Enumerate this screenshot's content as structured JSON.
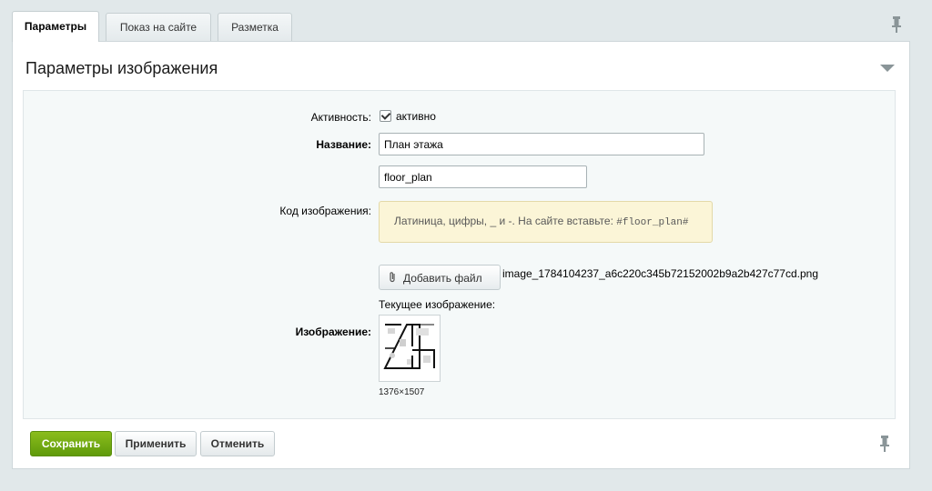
{
  "tabs": [
    {
      "label": "Параметры",
      "active": true
    },
    {
      "label": "Показ на сайте",
      "active": false
    },
    {
      "label": "Разметка",
      "active": false
    }
  ],
  "section": {
    "title": "Параметры изображения"
  },
  "form": {
    "activity_label": "Активность:",
    "activity_checkbox_text": "активно",
    "activity_checked": true,
    "name_label": "Название:",
    "name_value": "План этажа",
    "code_value": "floor_plan",
    "code_label": "Код изображения:",
    "code_hint_text": "Латиница, цифры, _ и -. На сайте вставьте: ",
    "code_hint_code": "#floor_plan#",
    "add_file_label": "Добавить файл",
    "file_name": "image_1784104237_a6c220c345b72152002b9a2b427c77cd.png",
    "current_image_label": "Текущее изображение:",
    "image_label": "Изображение:",
    "image_dimensions": "1376×1507"
  },
  "buttons": {
    "save": "Сохранить",
    "apply": "Применить",
    "cancel": "Отменить"
  },
  "colors": {
    "save_button": "#6fa713",
    "hint_background": "#fbf5d7",
    "page_background": "#e1e8ea"
  },
  "icons": [
    "pin-icon",
    "collapse-arrow-icon",
    "paperclip-icon"
  ]
}
